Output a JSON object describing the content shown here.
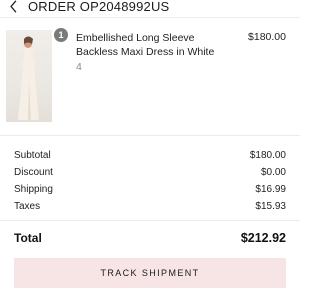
{
  "header": {
    "title": "ORDER OP2048992US"
  },
  "item": {
    "quantity": "1",
    "name": "Embellished Long Sleeve Backless Maxi Dress in White",
    "size": "4",
    "price": "$180.00"
  },
  "summary": {
    "rows": [
      {
        "label": "Subtotal",
        "value": "$180.00"
      },
      {
        "label": "Discount",
        "value": "$0.00"
      },
      {
        "label": "Shipping",
        "value": "$16.99"
      },
      {
        "label": "Taxes",
        "value": "$15.93"
      }
    ],
    "total_label": "Total",
    "total_value": "$212.92"
  },
  "actions": {
    "track_label": "TRACK SHIPMENT"
  },
  "icons": {
    "back": "chevron-left-icon"
  },
  "colors": {
    "button_bg": "#f7e4e4",
    "badge_bg": "#7a7a7a"
  }
}
